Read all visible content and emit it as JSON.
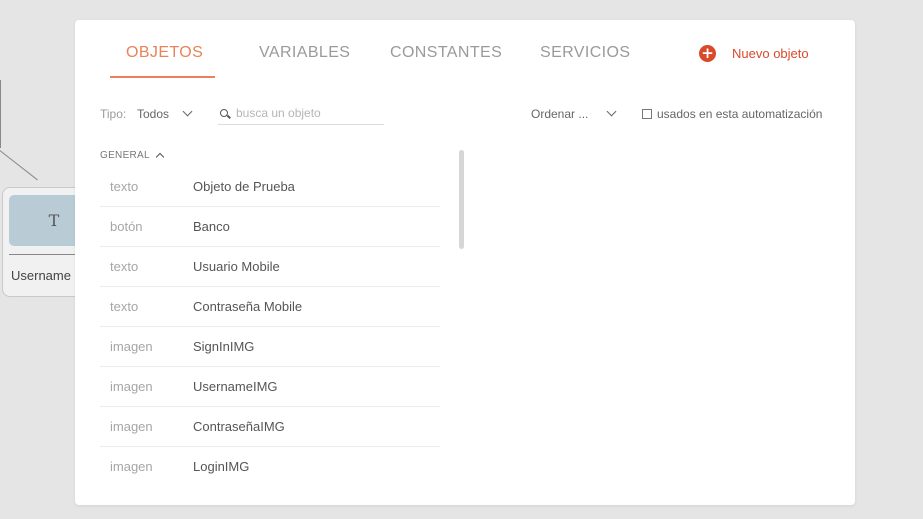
{
  "background": {
    "node_icon": "T",
    "node_label": "Username"
  },
  "tabs": [
    {
      "label": "OBJETOS",
      "active": true
    },
    {
      "label": "VARIABLES",
      "active": false
    },
    {
      "label": "CONSTANTES",
      "active": false
    },
    {
      "label": "SERVICIOS",
      "active": false
    }
  ],
  "new_button": {
    "label": "Nuevo objeto",
    "icon": "plus-circle-icon",
    "color": "#d94a2a"
  },
  "filters": {
    "type_label": "Tipo:",
    "type_value": "Todos",
    "search_placeholder": "busca un objeto",
    "sort_label": "Ordenar ...",
    "used_label": "usados en esta automatización",
    "used_checked": false
  },
  "group": {
    "label": "GENERAL",
    "expanded": true
  },
  "objects": [
    {
      "type": "texto",
      "name": "Objeto de Prueba"
    },
    {
      "type": "botón",
      "name": "Banco"
    },
    {
      "type": "texto",
      "name": "Usuario Mobile"
    },
    {
      "type": "texto",
      "name": "Contraseña Mobile"
    },
    {
      "type": "imagen",
      "name": "SignInIMG"
    },
    {
      "type": "imagen",
      "name": "UsernameIMG"
    },
    {
      "type": "imagen",
      "name": "ContraseñaIMG"
    },
    {
      "type": "imagen",
      "name": "LoginIMG"
    }
  ],
  "colors": {
    "accent": "#e8825a",
    "danger": "#d94a2a"
  }
}
